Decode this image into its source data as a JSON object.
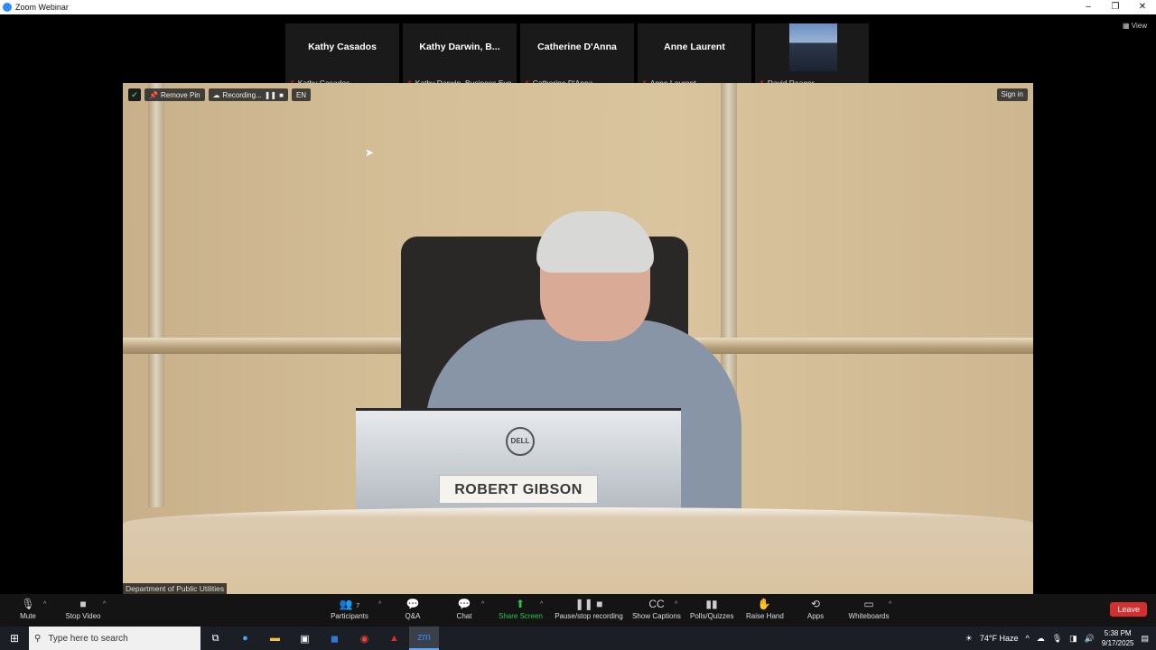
{
  "window": {
    "title": "Zoom Webinar",
    "controls": [
      "–",
      "❐",
      "✕"
    ]
  },
  "top_right": {
    "view_label": "View"
  },
  "participants_strip": [
    {
      "name": "Kathy Casados",
      "label": "Kathy Casados"
    },
    {
      "name": "Kathy Darwin, B...",
      "label": "Kathy Darwin, Business Evo..."
    },
    {
      "name": "Catherine D'Anna",
      "label": "Catherine D'Anna"
    },
    {
      "name": "Anne Laurent",
      "label": "Anne Laurent"
    },
    {
      "name": "",
      "label": "David Reagor"
    }
  ],
  "video_overlay": {
    "remove_pin": "Remove Pin",
    "recording": "Recording...",
    "language": "EN",
    "sign_in": "Sign in",
    "speaker_label": "Department of Public Utilities",
    "nameplate": "ROBERT GIBSON",
    "monitor_brand": "DELL"
  },
  "toolbar": {
    "mute": "Mute",
    "stop_video": "Stop Video",
    "participants": "Participants",
    "participants_count": "7",
    "qa": "Q&A",
    "chat": "Chat",
    "share_screen": "Share Screen",
    "pause_recording": "Pause/stop recording",
    "show_captions": "Show Captions",
    "polls": "Polls/Quizzes",
    "raise_hand": "Raise Hand",
    "apps": "Apps",
    "whiteboards": "Whiteboards",
    "leave": "Leave"
  },
  "taskbar": {
    "search_placeholder": "Type here to search",
    "weather": "74°F  Haze",
    "time": "5:38 PM",
    "date": "9/17/2025"
  },
  "colors": {
    "accent": "#2d8cff",
    "leave": "#d32f2f",
    "share": "#29c34a"
  }
}
